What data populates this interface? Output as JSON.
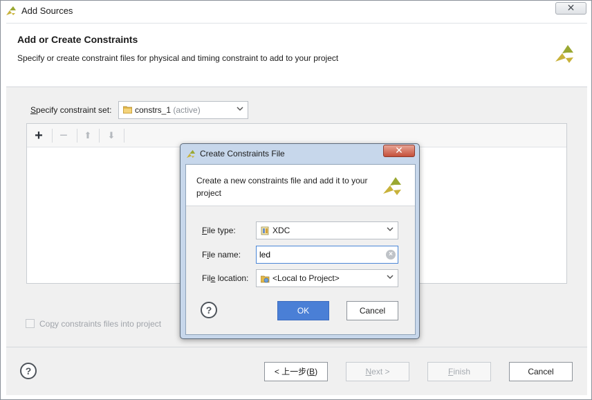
{
  "window": {
    "title": "Add Sources",
    "close_glyph": "✕"
  },
  "header": {
    "title": "Add or Create Constraints",
    "description": "Specify or create constraint files for physical and timing constraint to add to your project"
  },
  "constraint_set": {
    "label_pre": "",
    "label_key": "S",
    "label_post": "pecify constraint set:",
    "value": "constrs_1",
    "value_suffix": "(active)"
  },
  "toolbar": {
    "add_glyph": "+",
    "remove_glyph": "−",
    "up_glyph": "⬆",
    "down_glyph": "⬇"
  },
  "copy_option": {
    "label_pre": "Co",
    "label_key": "p",
    "label_post": "y constraints files into project",
    "checked": false
  },
  "footer": {
    "help_glyph": "?",
    "back_pre": "< ",
    "back_main": "上一步(",
    "back_key": "B",
    "back_post": ")",
    "next_key": "N",
    "next_post": "ext >",
    "finish_key": "F",
    "finish_post": "inish",
    "cancel": "Cancel"
  },
  "dialog": {
    "title": "Create Constraints File",
    "close_glyph": "✕",
    "description": "Create a new constraints file and add it to your project",
    "file_type": {
      "label_key": "F",
      "label_post": "ile type:",
      "value": "XDC"
    },
    "file_name": {
      "label_pre": "F",
      "label_key": "i",
      "label_post": "le name:",
      "value": "led",
      "clear_glyph": "×"
    },
    "file_location": {
      "label_pre": "Fil",
      "label_key": "e",
      "label_post": " location:",
      "value": "<Local to Project>"
    },
    "help_glyph": "?",
    "ok": "OK",
    "cancel": "Cancel"
  },
  "colors": {
    "accent": "#4a7fd6",
    "logo": "#c8b23a",
    "dialog_frame": "#c7d7eb",
    "close_red": "#c5503a"
  }
}
